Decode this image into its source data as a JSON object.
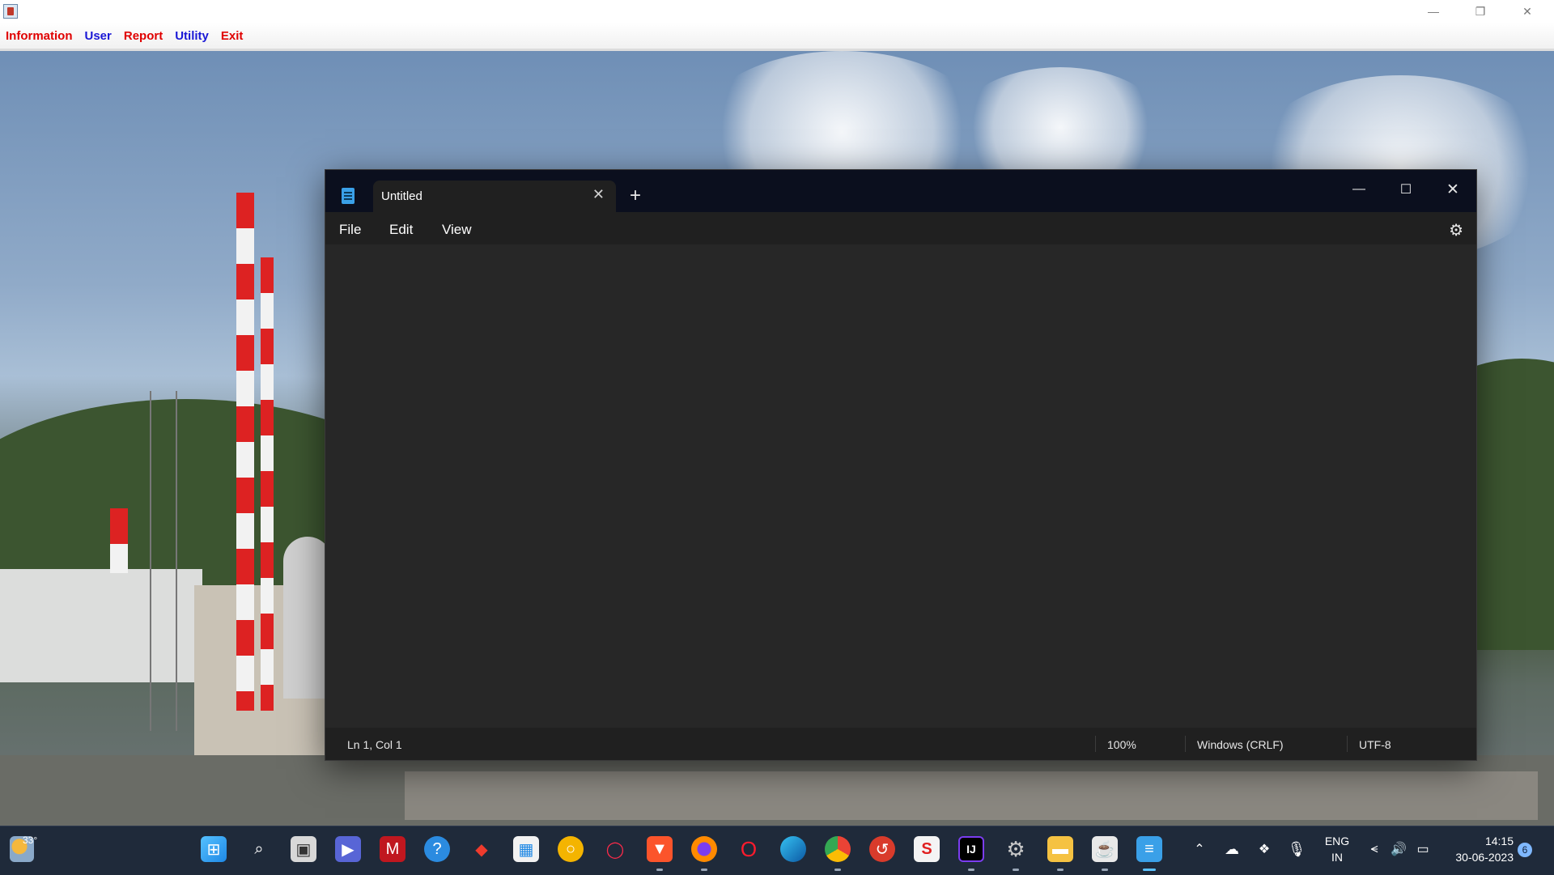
{
  "app": {
    "menus": [
      {
        "label": "Information",
        "color": "#e00000"
      },
      {
        "label": "User",
        "color": "#1a18d6"
      },
      {
        "label": "Report",
        "color": "#e00000"
      },
      {
        "label": "Utility",
        "color": "#1a18d6"
      },
      {
        "label": "Exit",
        "color": "#e00000"
      }
    ]
  },
  "notepad": {
    "tab_title": "Untitled",
    "menu": {
      "file": "File",
      "edit": "Edit",
      "view": "View"
    },
    "status": {
      "position": "Ln 1, Col 1",
      "zoom": "100%",
      "line_ending": "Windows (CRLF)",
      "encoding": "UTF-8"
    }
  },
  "taskbar": {
    "weather": "33°",
    "language_line1": "ENG",
    "language_line2": "IN",
    "time": "14:15",
    "date": "30-06-2023",
    "notifications": "6",
    "pinned": [
      "start-icon",
      "search-icon",
      "task-view-icon",
      "chat-icon",
      "mcafee-icon",
      "help-icon",
      "anydesk-icon",
      "microsoft-store-icon",
      "yellow-app-icon",
      "opera-gx-icon",
      "brave-icon",
      "firefox-icon",
      "opera-icon",
      "edge-icon",
      "chrome-icon",
      "red-app-icon",
      "red-s-app-icon",
      "intellij-icon",
      "settings-icon",
      "file-explorer-icon",
      "java-icon",
      "notepad-icon"
    ]
  }
}
